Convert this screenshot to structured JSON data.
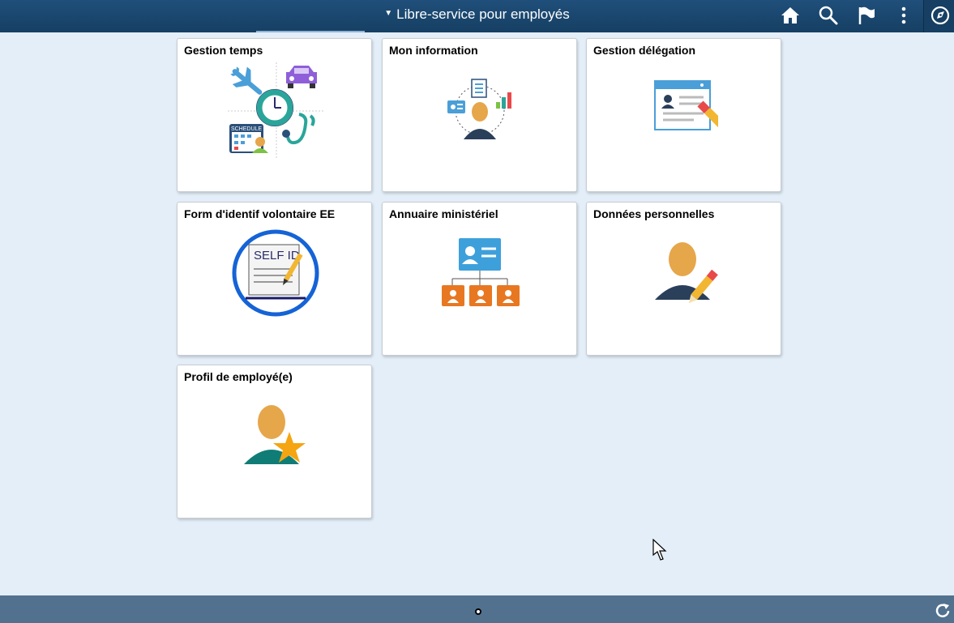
{
  "header": {
    "title": "Libre-service pour employés",
    "icons": [
      "home-icon",
      "search-icon",
      "flag-icon",
      "more-vertical-icon",
      "navbar-compass-icon"
    ]
  },
  "tiles": [
    {
      "title": "Gestion temps",
      "icon": "time-management-collage-icon",
      "schedule_label": "SCHEDULE"
    },
    {
      "title": "Mon information",
      "icon": "person-info-icon"
    },
    {
      "title": "Gestion délégation",
      "icon": "profile-card-pencil-icon"
    },
    {
      "title": "Form d'identif volontaire EE",
      "icon": "self-id-form-icon",
      "badge_text": "SELF ID"
    },
    {
      "title": "Annuaire ministériel",
      "icon": "org-chart-icon"
    },
    {
      "title": "Données personnelles",
      "icon": "person-pencil-icon"
    },
    {
      "title": "Profil de employé(e)",
      "icon": "person-star-icon"
    }
  ],
  "footer": {
    "icons": [
      "page-indicator-dot",
      "refresh-icon"
    ]
  },
  "colors": {
    "header_bg": "#1f4f7a",
    "page_bg": "#e3eef8",
    "footer_bg": "#51718f",
    "accent_orange": "#e87722",
    "accent_skin": "#e6a64a"
  }
}
